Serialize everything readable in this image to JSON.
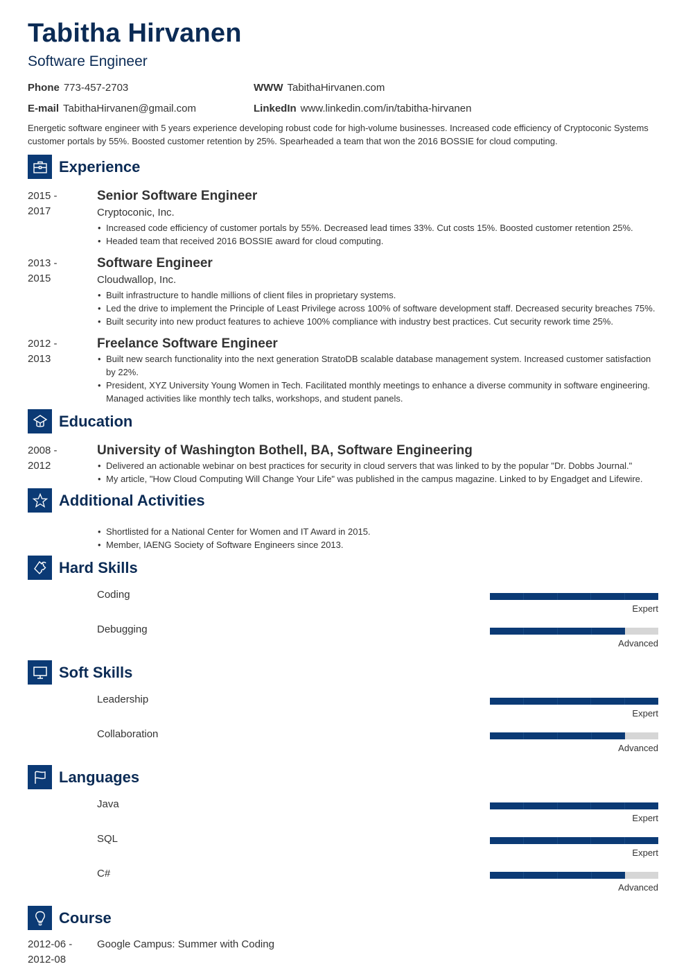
{
  "header": {
    "name": "Tabitha Hirvanen",
    "title": "Software Engineer"
  },
  "contacts": [
    {
      "label": "Phone",
      "value": "773-457-2703"
    },
    {
      "label": "WWW",
      "value": "TabithaHirvanen.com"
    },
    {
      "label": "E-mail",
      "value": "TabithaHirvanen@gmail.com"
    },
    {
      "label": "LinkedIn",
      "value": "www.linkedin.com/in/tabitha-hirvanen"
    }
  ],
  "summary": "Energetic software engineer with 5 years experience developing robust code for high-volume businesses. Increased code efficiency of Cryptoconic Systems customer portals by 55%. Boosted customer retention by 25%. Spearheaded a team that won the 2016 BOSSIE for cloud computing.",
  "accent_color": "#0b3a75",
  "sections": {
    "experience": {
      "title": "Experience",
      "icon": "briefcase-icon",
      "entries": [
        {
          "date_start": "2015 -",
          "date_end": "2017",
          "title": "Senior Software Engineer",
          "company": "Cryptoconic, Inc.",
          "bullets": [
            "Increased code efficiency of customer portals by 55%. Decreased lead times 33%. Cut costs 15%. Boosted customer retention 25%.",
            "Headed team that received 2016 BOSSIE award for cloud computing."
          ]
        },
        {
          "date_start": "2013 -",
          "date_end": "2015",
          "title": "Software Engineer",
          "company": "Cloudwallop, Inc.",
          "bullets": [
            "Built infrastructure to handle millions of client files in proprietary systems.",
            "Led the drive to implement the Principle of Least Privilege across 100% of software development staff. Decreased security breaches 75%.",
            "Built security into new product features to achieve 100% compliance with industry best practices. Cut security rework time 25%."
          ]
        },
        {
          "date_start": "2012 -",
          "date_end": "2013",
          "title": "Freelance Software Engineer",
          "bullets": [
            "Built new search functionality into the next generation StratoDB scalable database management system. Increased customer satisfaction by 22%.",
            "President, XYZ University Young Women in Tech. Facilitated monthly meetings to enhance a diverse community in software engineering. Managed activities like monthly tech talks, workshops, and student panels."
          ]
        }
      ]
    },
    "education": {
      "title": "Education",
      "icon": "graduation-cap-icon",
      "entries": [
        {
          "date_start": "2008 -",
          "date_end": "2012",
          "title": "University of Washington Bothell, BA, Software Engineering",
          "bullets": [
            "Delivered an actionable webinar on best practices for security in cloud servers that was linked to by the popular \"Dr. Dobbs Journal.\"",
            "My article, \"How Cloud Computing Will Change Your Life\" was published in the campus magazine. Linked to by Engadget and Lifewire."
          ]
        }
      ]
    },
    "activities": {
      "title": "Additional Activities",
      "icon": "star-icon",
      "bullets": [
        "Shortlisted for a National Center for Women and IT Award in 2015.",
        "Member, IAENG Society of Software Engineers since 2013."
      ]
    },
    "hard_skills": {
      "title": "Hard Skills",
      "icon": "puzzle-icon",
      "items": [
        {
          "name": "Coding",
          "level": "Expert",
          "rating": 5,
          "max": 5
        },
        {
          "name": "Debugging",
          "level": "Advanced",
          "rating": 4,
          "max": 5
        }
      ]
    },
    "soft_skills": {
      "title": "Soft Skills",
      "icon": "monitor-icon",
      "items": [
        {
          "name": "Leadership",
          "level": "Expert",
          "rating": 5,
          "max": 5
        },
        {
          "name": "Collaboration",
          "level": "Advanced",
          "rating": 4,
          "max": 5
        }
      ]
    },
    "languages": {
      "title": "Languages",
      "icon": "flag-icon",
      "items": [
        {
          "name": "Java",
          "level": "Expert",
          "rating": 5,
          "max": 5
        },
        {
          "name": "SQL",
          "level": "Expert",
          "rating": 5,
          "max": 5
        },
        {
          "name": "C#",
          "level": "Advanced",
          "rating": 4,
          "max": 5
        }
      ]
    },
    "course": {
      "title": "Course",
      "icon": "lightbulb-icon",
      "entries": [
        {
          "date_start": "2012-06 -",
          "date_end": "2012-08",
          "title": "Google Campus: Summer with Coding"
        }
      ]
    }
  }
}
